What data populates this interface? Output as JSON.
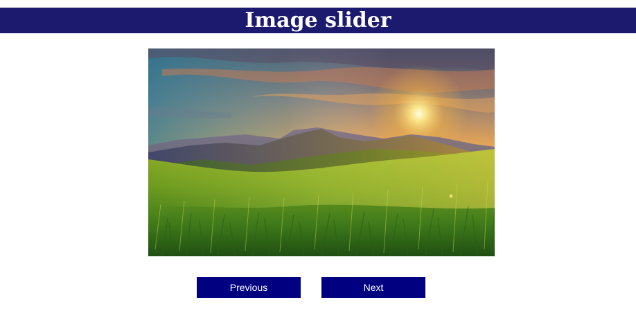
{
  "header": {
    "title": "Image slider",
    "background_color": "#1b1a6f"
  },
  "slider": {
    "current_slide": {
      "alt": "Sunrise over green mountain meadow",
      "scene": "mountain-sunrise-meadow"
    }
  },
  "controls": {
    "previous_label": "Previous",
    "next_label": "Next",
    "button_color": "#000080"
  }
}
